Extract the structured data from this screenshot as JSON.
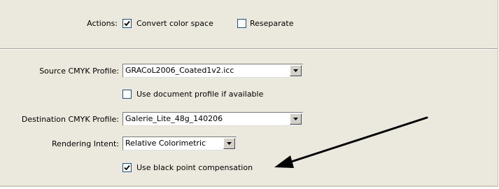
{
  "actions": {
    "label": "Actions:",
    "convert_color_space": {
      "label": "Convert color space",
      "checked": true
    },
    "reseparate": {
      "label": "Reseparate",
      "checked": false
    }
  },
  "source_profile": {
    "label": "Source CMYK Profile:",
    "value": "GRACoL2006_Coated1v2.icc",
    "use_document_profile": {
      "label": "Use document profile if available",
      "checked": false
    }
  },
  "destination_profile": {
    "label": "Destination CMYK Profile:",
    "value": "Galerie_Lite_48g_140206"
  },
  "rendering_intent": {
    "label": "Rendering Intent:",
    "value": "Relative Colorimetric"
  },
  "black_point_compensation": {
    "label": "Use black point compensation",
    "checked": true
  },
  "icons": {
    "checkmark": "checkmark-icon",
    "dropdown": "chevron-down-icon",
    "annotation": "arrow-annotation"
  }
}
